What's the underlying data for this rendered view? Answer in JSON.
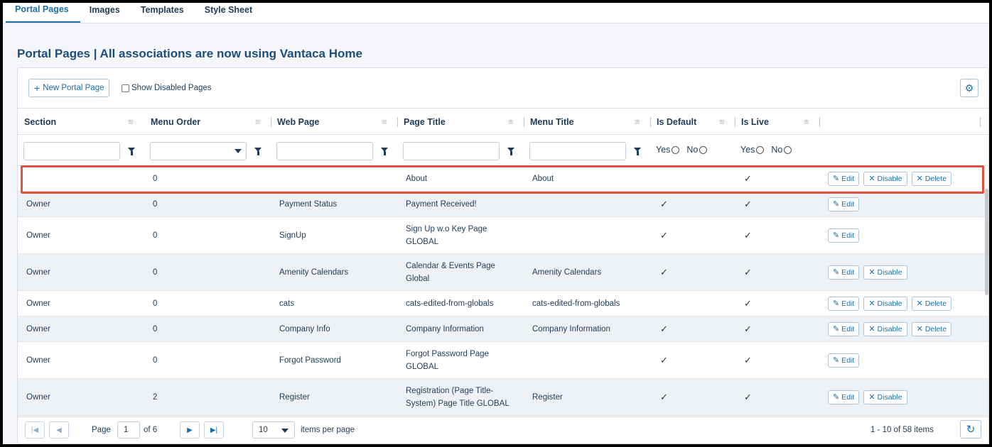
{
  "tabs": [
    {
      "label": "Portal Pages",
      "active": true
    },
    {
      "label": "Images",
      "active": false
    },
    {
      "label": "Templates",
      "active": false
    },
    {
      "label": "Style Sheet",
      "active": false
    }
  ],
  "page_title": "Portal Pages | All associations are now using Vantaca Home",
  "toolbar": {
    "new_button": "New Portal Page",
    "show_disabled": "Show Disabled Pages"
  },
  "columns": [
    "Section",
    "Menu Order",
    "Web Page",
    "Page Title",
    "Menu Title",
    "Is Default",
    "Is Live"
  ],
  "filters": {
    "yes": "Yes",
    "no": "No"
  },
  "actions": {
    "edit": "Edit",
    "disable": "Disable",
    "delete": "Delete"
  },
  "rows": [
    {
      "section": "",
      "menu_order": "0",
      "web_page": "",
      "page_title": "About",
      "menu_title": "About",
      "is_default": false,
      "is_live": true,
      "buttons": [
        "edit",
        "disable",
        "delete"
      ]
    },
    {
      "section": "Owner",
      "menu_order": "0",
      "web_page": "Payment Status",
      "page_title": "Payment Received!",
      "menu_title": "",
      "is_default": true,
      "is_live": true,
      "buttons": [
        "edit"
      ]
    },
    {
      "section": "Owner",
      "menu_order": "0",
      "web_page": "SignUp",
      "page_title": "Sign Up w.o Key Page GLOBAL",
      "menu_title": "",
      "is_default": true,
      "is_live": true,
      "buttons": [
        "edit"
      ]
    },
    {
      "section": "Owner",
      "menu_order": "0",
      "web_page": "Amenity Calendars",
      "page_title": "Calendar & Events Page Global",
      "menu_title": "Amenity Calendars",
      "is_default": true,
      "is_live": true,
      "buttons": [
        "edit",
        "disable"
      ]
    },
    {
      "section": "Owner",
      "menu_order": "0",
      "web_page": "cats",
      "page_title": "cats-edited-from-globals",
      "menu_title": "cats-edited-from-globals",
      "is_default": false,
      "is_live": true,
      "buttons": [
        "edit",
        "disable",
        "delete"
      ]
    },
    {
      "section": "Owner",
      "menu_order": "0",
      "web_page": "Company Info",
      "page_title": "Company Information",
      "menu_title": "Company Information",
      "is_default": true,
      "is_live": true,
      "buttons": [
        "edit",
        "disable",
        "delete"
      ]
    },
    {
      "section": "Owner",
      "menu_order": "0",
      "web_page": "Forgot Password",
      "page_title": "Forgot Password Page GLOBAL",
      "menu_title": "",
      "is_default": true,
      "is_live": true,
      "buttons": [
        "edit"
      ]
    },
    {
      "section": "Owner",
      "menu_order": "2",
      "web_page": "Register",
      "page_title": "Registration (Page Title-System) Page Title GLOBAL",
      "menu_title": "Register",
      "is_default": true,
      "is_live": true,
      "buttons": [
        "edit",
        "disable"
      ]
    }
  ],
  "pager": {
    "page_label": "Page",
    "current_page": "1",
    "of_label": "of 6",
    "page_size": "10",
    "per_page_label": "items per page",
    "summary": "1 - 10 of 58 items"
  },
  "icons": {
    "edit": "✎",
    "disable": "✕",
    "delete": "✕",
    "check": "✓",
    "gear": "⚙",
    "refresh": "↻"
  },
  "colors": {
    "accent": "#1b6fa8",
    "highlight": "#e15240",
    "alt_row": "#eef2f7"
  }
}
